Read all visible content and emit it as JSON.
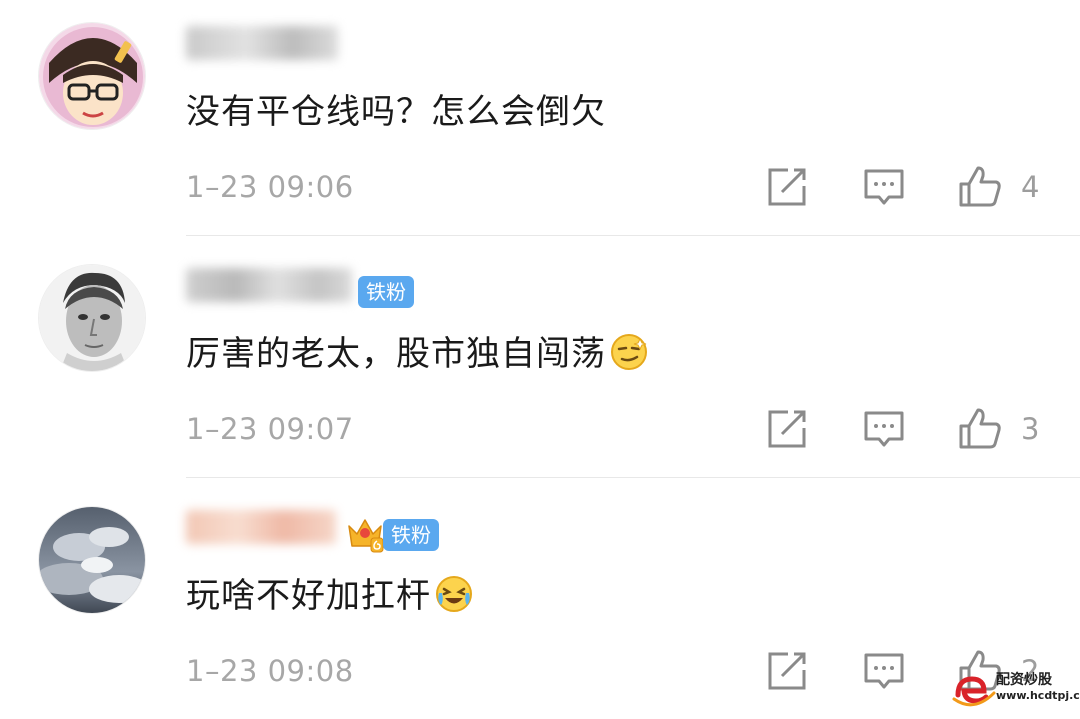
{
  "comments": [
    {
      "text": "没有平仓线吗？怎么会倒欠",
      "time": "1–23 09:06",
      "likes": "4",
      "badge": ""
    },
    {
      "text": "厉害的老太，股市独自闯荡",
      "time": "1–23 09:07",
      "likes": "3",
      "badge": "铁粉"
    },
    {
      "text": "玩啥不好加扛杆",
      "time": "1–23 09:08",
      "likes": "2",
      "badge": "铁粉"
    }
  ],
  "icons": {
    "share": "share-icon",
    "reply": "comment-icon",
    "like": "thumbs-up-icon"
  },
  "colors": {
    "badge": "#5aa8ef",
    "timestamp": "#a7a7a7",
    "divider": "#e8e8e8"
  },
  "watermark": {
    "title": "配资炒股",
    "url": "www.hcdtpj.com"
  }
}
